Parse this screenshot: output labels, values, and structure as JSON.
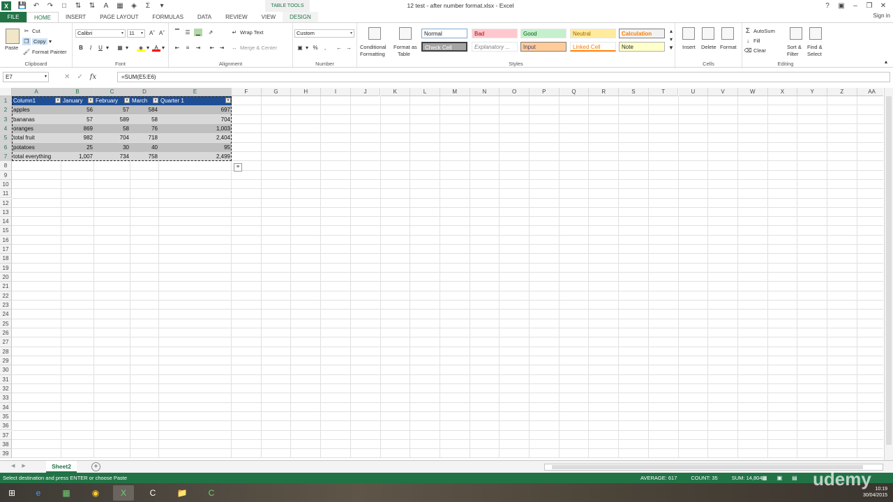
{
  "title_bar": {
    "window_title": "12 test - after number format.xlsx - Excel",
    "table_tools": "TABLE TOOLS",
    "sign_in": "Sign in"
  },
  "tabs": {
    "file": "FILE",
    "home": "HOME",
    "insert": "INSERT",
    "page_layout": "PAGE LAYOUT",
    "formulas": "FORMULAS",
    "data": "DATA",
    "review": "REVIEW",
    "view": "VIEW",
    "design": "DESIGN"
  },
  "ribbon": {
    "clipboard": {
      "label": "Clipboard",
      "paste": "Paste",
      "cut": "Cut",
      "copy": "Copy",
      "format_painter": "Format Painter"
    },
    "font": {
      "label": "Font",
      "name": "Calibri",
      "size": "11",
      "bold": "B",
      "italic": "I",
      "underline": "U"
    },
    "alignment": {
      "label": "Alignment",
      "wrap_text": "Wrap Text",
      "merge_center": "Merge & Center"
    },
    "number": {
      "label": "Number",
      "format": "Custom",
      "percent": "%"
    },
    "styles": {
      "label": "Styles",
      "conditional_formatting_1": "Conditional",
      "conditional_formatting_2": "Formatting",
      "format_as_table_1": "Format as",
      "format_as_table_2": "Table",
      "normal": "Normal",
      "bad": "Bad",
      "good": "Good",
      "neutral": "Neutral",
      "calculation": "Calculation",
      "check_cell": "Check Cell",
      "explanatory": "Explanatory ...",
      "input": "Input",
      "linked_cell": "Linked Cell",
      "note": "Note"
    },
    "cells": {
      "label": "Cells",
      "insert": "Insert",
      "delete": "Delete",
      "format": "Format"
    },
    "editing": {
      "label": "Editing",
      "autosum": "AutoSum",
      "fill": "Fill",
      "clear": "Clear",
      "sort_filter_1": "Sort &",
      "sort_filter_2": "Filter",
      "find_select_1": "Find &",
      "find_select_2": "Select"
    }
  },
  "formula_bar": {
    "name_box": "E7",
    "fx": "fx",
    "formula": "=SUM(E5:E6)"
  },
  "columns": [
    "A",
    "B",
    "C",
    "D",
    "E",
    "F",
    "G",
    "H",
    "I",
    "J",
    "K",
    "L",
    "M",
    "N",
    "O",
    "P",
    "Q",
    "R",
    "S",
    "T",
    "U",
    "V",
    "W",
    "X",
    "Y",
    "Z",
    "AA"
  ],
  "rows": [
    "1",
    "2",
    "3",
    "4",
    "5",
    "6",
    "7",
    "8",
    "9",
    "10",
    "11",
    "12",
    "13",
    "14",
    "15",
    "16",
    "17",
    "18",
    "19",
    "20",
    "21",
    "22",
    "23",
    "24",
    "25",
    "26",
    "27",
    "28",
    "29",
    "30",
    "31",
    "32",
    "33",
    "34",
    "35",
    "36",
    "37",
    "38",
    "39"
  ],
  "table": {
    "headers": [
      "Column1",
      "January",
      "February",
      "March",
      "Quarter 1"
    ],
    "rows": [
      [
        "apples",
        "56",
        "57",
        "584",
        "697"
      ],
      [
        "bananas",
        "57",
        "589",
        "58",
        "704"
      ],
      [
        "oranges",
        "869",
        "58",
        "76",
        "1,003"
      ],
      [
        "total fruit",
        "982",
        "704",
        "718",
        "2,404"
      ],
      [
        "potatoes",
        "25",
        "30",
        "40",
        "95"
      ],
      [
        "total everything",
        "1,007",
        "734",
        "758",
        "2,499"
      ]
    ]
  },
  "sheets": {
    "active": "Sheet2",
    "add": "+"
  },
  "status_bar": {
    "message": "Select destination and press ENTER or choose Paste",
    "average": "AVERAGE: 617",
    "count": "COUNT: 35",
    "sum": "SUM: 14,804"
  },
  "taskbar": {
    "time": "10:19",
    "date": "30/04/2015"
  },
  "watermark": "udemy",
  "colors": {
    "excel_green": "#217346",
    "table_header": "#1f4e94",
    "band_dark": "#bfbfbf",
    "band_light": "#d9d9d9",
    "style_bad_bg": "#ffc7ce",
    "style_good_bg": "#c6efce",
    "style_neutral_bg": "#ffeb9c",
    "style_check_bg": "#a5a5a5",
    "style_input_bg": "#ffcc99"
  }
}
